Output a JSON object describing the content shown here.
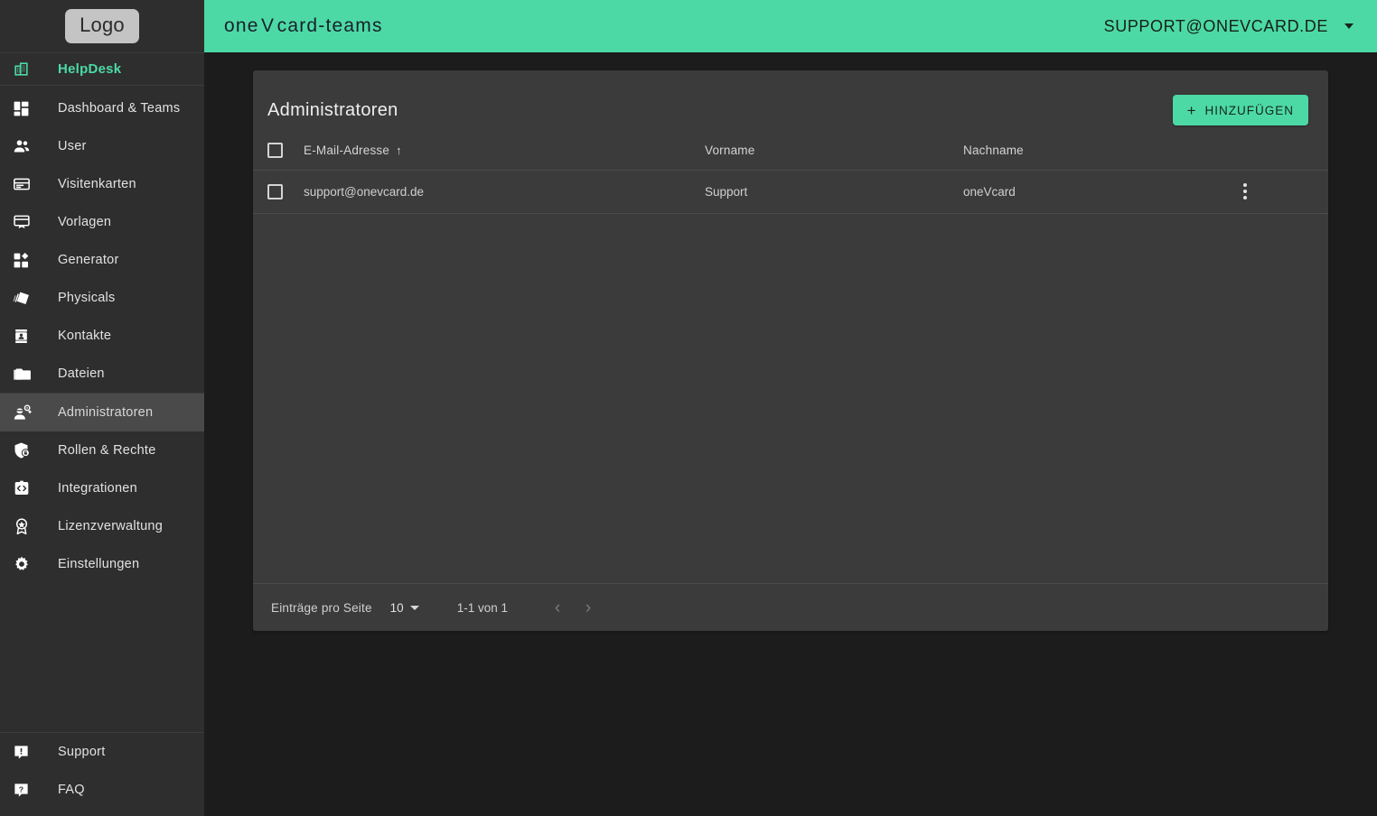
{
  "colors": {
    "accent": "#4dd9a5",
    "sidebar_bg": "#2e2e2e",
    "page_bg": "#1c1c1c",
    "card_bg": "#3b3b3b",
    "active_item_bg": "#4a4a4a",
    "logo_box_bg": "#c4c4c4"
  },
  "sidebar": {
    "logo_text": "Logo",
    "helpdesk": {
      "label": "HelpDesk",
      "icon": "building-icon"
    },
    "items": [
      {
        "label": "Dashboard & Teams",
        "icon": "dashboard-grid-icon",
        "active": false
      },
      {
        "label": "User",
        "icon": "users-icon",
        "active": false
      },
      {
        "label": "Visitenkarten",
        "icon": "business-card-icon",
        "active": false
      },
      {
        "label": "Vorlagen",
        "icon": "template-monitor-icon",
        "active": false
      },
      {
        "label": "Generator",
        "icon": "generator-blocks-icon",
        "active": false
      },
      {
        "label": "Physicals",
        "icon": "cards-stack-icon",
        "active": false
      },
      {
        "label": "Kontakte",
        "icon": "contact-card-icon",
        "active": false
      },
      {
        "label": "Dateien",
        "icon": "folder-icon",
        "active": false
      },
      {
        "label": "Administratoren",
        "icon": "admin-user-gear-icon",
        "active": true
      },
      {
        "label": "Rollen & Rechte",
        "icon": "shield-lock-icon",
        "active": false
      },
      {
        "label": "Integrationen",
        "icon": "code-badge-icon",
        "active": false
      },
      {
        "label": "Lizenzverwaltung",
        "icon": "license-award-icon",
        "active": false
      },
      {
        "label": "Einstellungen",
        "icon": "gear-icon",
        "active": false
      }
    ],
    "bottom_items": [
      {
        "label": "Support",
        "icon": "support-chat-icon"
      },
      {
        "label": "FAQ",
        "icon": "faq-question-icon"
      }
    ]
  },
  "topbar": {
    "brand_part1": "one",
    "brand_v": "V",
    "brand_part2": "card",
    "brand_part3": "-teams",
    "brand_full": "oneVcard-teams",
    "account_email": "SUPPORT@ONEVCARD.DE",
    "account_caret": "chevron-down-icon"
  },
  "main": {
    "title": "Administratoren",
    "add_button": {
      "label": "HINZUFÜGEN",
      "icon": "plus-icon"
    },
    "table": {
      "headers": [
        {
          "label": "E-Mail-Adresse",
          "sorted": true,
          "sort_direction": "asc",
          "sort_glyph": "↑"
        },
        {
          "label": "Vorname",
          "sorted": false
        },
        {
          "label": "Nachname",
          "sorted": false
        }
      ],
      "rows": [
        {
          "email": "support@onevcard.de",
          "vorname": "Support",
          "nachname": "oneVcard",
          "checked": false
        }
      ],
      "select_all_checked": false,
      "row_menu_icon": "kebab-menu-icon"
    },
    "footer": {
      "per_page_label": "Einträge pro Seite",
      "per_page_value": "10",
      "range_text": "1-1 von 1",
      "prev_glyph": "‹",
      "next_glyph": "›"
    }
  }
}
